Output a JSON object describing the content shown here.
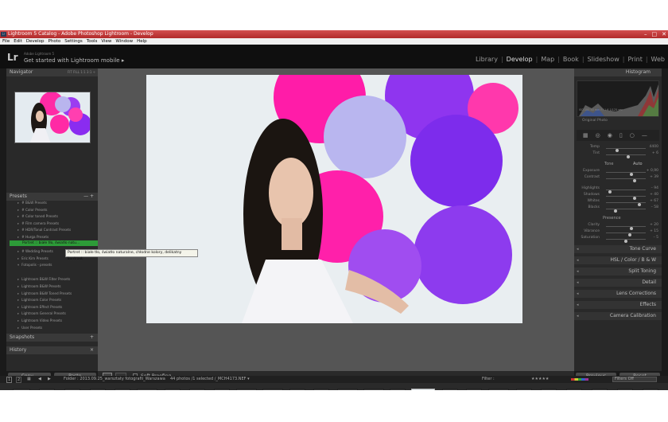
{
  "titlebar": {
    "app_title": "Lightroom 5 Catalog - Adobe Photoshop Lightroom - Develop",
    "icon": "Lr",
    "minimize": "–",
    "maximize": "□",
    "close": "✕"
  },
  "menubar": {
    "items": [
      "File",
      "Edit",
      "Develop",
      "Photo",
      "Settings",
      "Tools",
      "View",
      "Window",
      "Help"
    ]
  },
  "identity": {
    "logo": "Lr",
    "subtitle": "Adobe Lightroom 5",
    "main": "Get started with Lightroom mobile ▸"
  },
  "modules": {
    "library": "Library",
    "develop": "Develop",
    "map": "Map",
    "book": "Book",
    "slideshow": "Slideshow",
    "print": "Print",
    "web": "Web",
    "sep": "|"
  },
  "navigator": {
    "title": "Navigator",
    "opts": "FIT  FILL  1:1  3:1 ÷"
  },
  "presets": {
    "title": "Presets",
    "add": "—  +",
    "folders": [
      "# B&W Presets",
      "# Color Presets",
      "# Color toned Presets",
      "# Film camera Presets",
      "# HDR/Tonal Contrast Presets",
      "# Hurga Presets",
      "# Velvia Presets",
      "# Wedding Presets",
      "Eric Kim Presets",
      "Fotopolis - presets"
    ],
    "selected": "Portret :: białe tło, światło natu…",
    "more": [
      "Lightroom B&W Filter Presets",
      "Lightroom B&W Presets",
      "Lightroom B&W Toned Presets",
      "Lightroom Color Presets",
      "Lightroom Effect Presets",
      "Lightroom General Presets",
      "Lightroom Video Presets",
      "User Presets"
    ]
  },
  "tooltip": "Portret :: białe tło, światło naturalne, chłodne kolory, delikatny kontrast",
  "snapshots": {
    "title": "Snapshots",
    "add": "+"
  },
  "history": {
    "title": "History",
    "clear": "×"
  },
  "leftbuttons": {
    "copy": "Copy...",
    "paste": "Paste"
  },
  "histogram": {
    "title": "Histogram",
    "info": "ISO 100     50 mm     f / 1.6     1/125 sec",
    "original": "Original Photo"
  },
  "basic": {
    "temp_label": "Temp",
    "temp_val": "4400",
    "tint_label": "Tint",
    "tint_val": "+ 6",
    "tone_label": "Tone",
    "auto": "Auto",
    "exposure_label": "Exposure",
    "exposure_val": "+ 0,90",
    "contrast_label": "Contrast",
    "contrast_val": "+ 39",
    "highlights_label": "Highlights",
    "highlights_val": "– 94",
    "shadows_label": "Shadows",
    "shadows_val": "+ 40",
    "whites_label": "Whites",
    "whites_val": "+ 67",
    "blacks_label": "Blacks",
    "blacks_val": "– 58",
    "presence_label": "Presence",
    "clarity_label": "Clarity",
    "clarity_val": "+ 20",
    "vibrance_label": "Vibrance",
    "vibrance_val": "+ 15",
    "saturation_label": "Saturation",
    "saturation_val": "– 5"
  },
  "sections": {
    "tone_curve": "Tone Curve",
    "hsl": "HSL  /  Color  /  B & W",
    "split": "Split Toning",
    "detail": "Detail",
    "lens": "Lens Corrections",
    "effects": "Effects",
    "camera": "Camera Calibration"
  },
  "rightbuttons": {
    "previous": "Previous",
    "reset": "Reset"
  },
  "toolbar": {
    "soft_proofing": "Soft Proofing"
  },
  "filmhdr": {
    "page1": "1",
    "page2": "2",
    "folder": "Folder : 2013.09.25_warsztaty fotografii_Warszawa",
    "count": "44 photos /1 selected /_MCH4173.NEF ▾",
    "filter": "Filter :",
    "filters_off": "Filters Off"
  }
}
